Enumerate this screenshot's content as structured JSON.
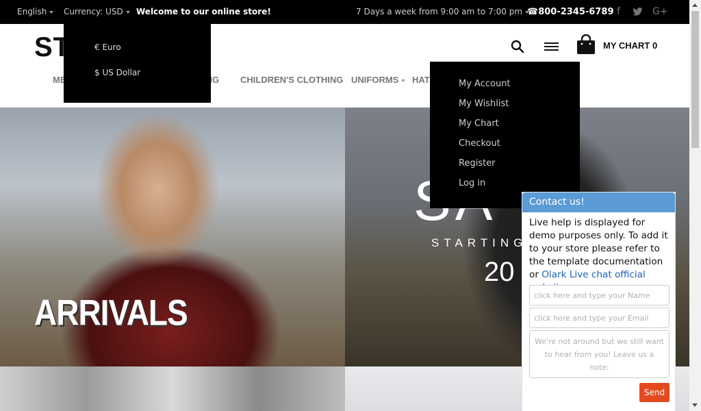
{
  "topbar": {
    "language": "English",
    "currency": "Currency: USD",
    "welcome": "Welcome to our online store!",
    "hours": "7 Days a week from 9:00 am to 7:00 pm",
    "phone": "800-2345-6789",
    "social": [
      "facebook-icon",
      "twitter-icon",
      "google-plus-icon"
    ]
  },
  "header": {
    "logo": "ST",
    "cart_label": "MY CHART 0"
  },
  "nav": {
    "items": [
      "ME",
      "ING",
      "CHILDREN'S CLOTHING",
      "UNIFORMS",
      "HATS"
    ]
  },
  "banners": {
    "left_title": "ARRIVALS",
    "right_title": "SA",
    "right_sub": "STARTING",
    "right_price": "20"
  },
  "currency_dropdown": {
    "options": [
      {
        "symbol": "€",
        "label": "Euro"
      },
      {
        "symbol": "$",
        "label": "US Dollar"
      }
    ]
  },
  "account_dropdown": {
    "options": [
      "My Account",
      "My Wishlist",
      "My Chart",
      "Checkout",
      "Register",
      "Log in"
    ]
  },
  "chat": {
    "title": "Contact us!",
    "message": "Live help is displayed for demo purposes only. To add it to your store please refer to the template documentation or",
    "link": "Olark Live chat official website.",
    "name_placeholder": "click here and type your Name",
    "email_placeholder": "click here and type your Email",
    "note_placeholder": "We're not around but we still want to hear from you! Leave us a note:",
    "send_label": "Send"
  },
  "colors": {
    "chat_header": "#5b9bd5",
    "send_button": "#e34b1f",
    "topbar": "#000000"
  }
}
